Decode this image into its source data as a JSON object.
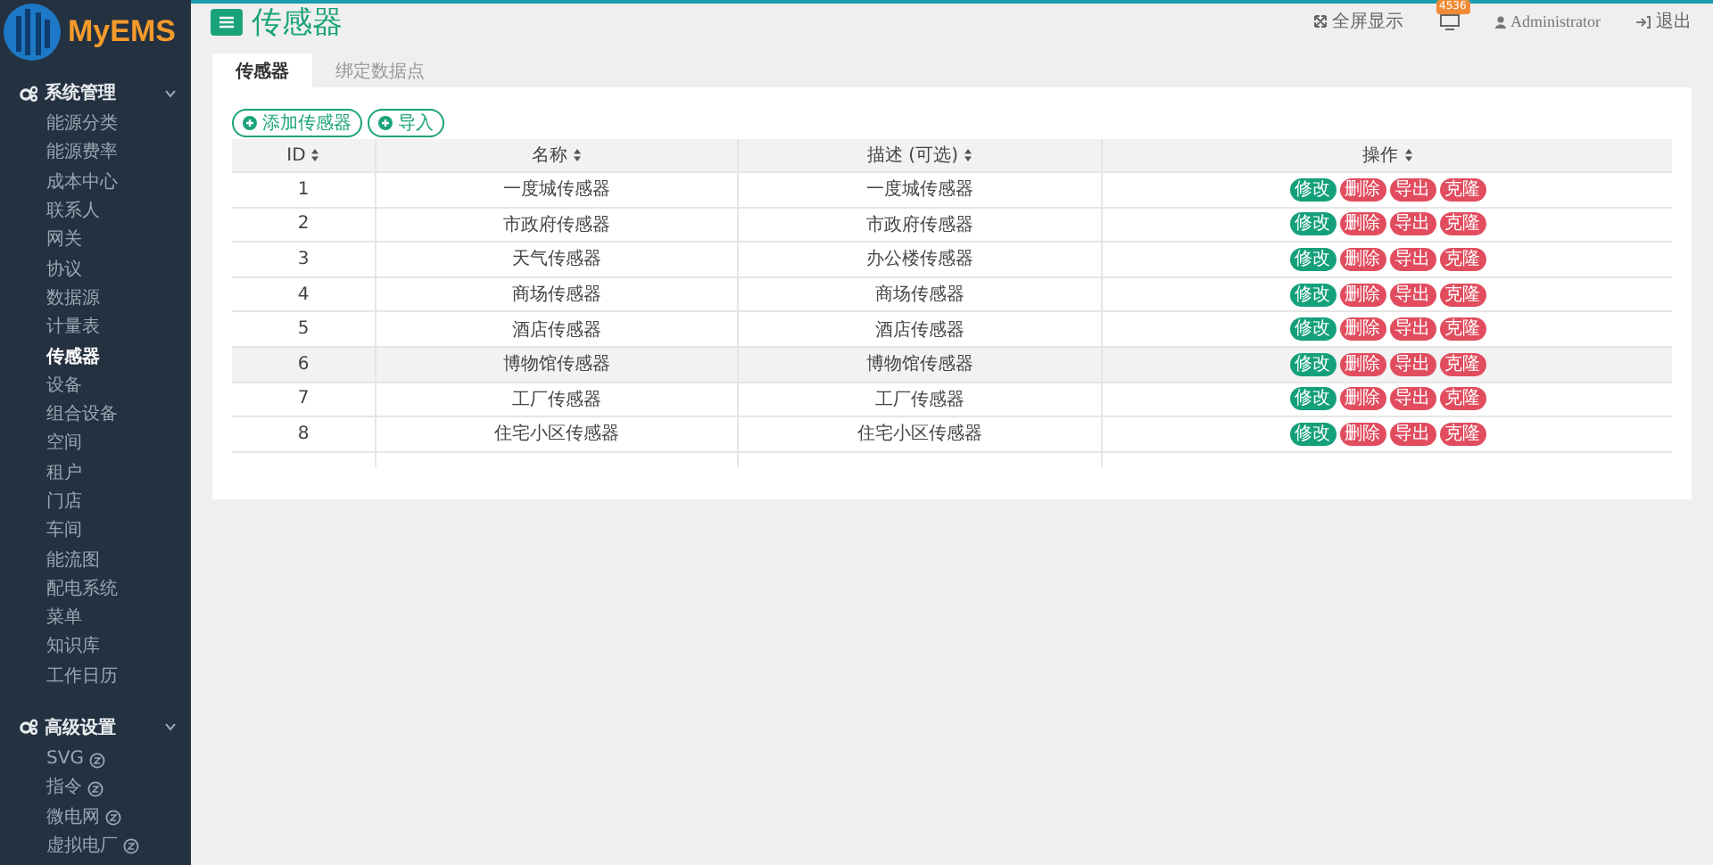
{
  "brand": {
    "name": "MyEMS"
  },
  "sidebar": {
    "groups": [
      {
        "label": "系统管理",
        "expanded": true,
        "items": [
          {
            "label": "能源分类",
            "selected": false,
            "kind": "plain"
          },
          {
            "label": "能源费率",
            "selected": false,
            "kind": "plain"
          },
          {
            "label": "成本中心",
            "selected": false,
            "kind": "plain"
          },
          {
            "label": "联系人",
            "selected": false,
            "kind": "plain"
          },
          {
            "label": "网关",
            "selected": false,
            "kind": "plain"
          },
          {
            "label": "协议",
            "selected": false,
            "kind": "plain"
          },
          {
            "label": "数据源",
            "selected": false,
            "kind": "plain"
          },
          {
            "label": "计量表",
            "selected": false,
            "kind": "plain"
          },
          {
            "label": "传感器",
            "selected": true,
            "kind": "plain"
          },
          {
            "label": "设备",
            "selected": false,
            "kind": "plain"
          },
          {
            "label": "组合设备",
            "selected": false,
            "kind": "plain"
          },
          {
            "label": "空间",
            "selected": false,
            "kind": "plain"
          },
          {
            "label": "租户",
            "selected": false,
            "kind": "plain"
          },
          {
            "label": "门店",
            "selected": false,
            "kind": "plain"
          },
          {
            "label": "车间",
            "selected": false,
            "kind": "plain"
          },
          {
            "label": "能流图",
            "selected": false,
            "kind": "plain"
          },
          {
            "label": "配电系统",
            "selected": false,
            "kind": "plain"
          },
          {
            "label": "菜单",
            "selected": false,
            "kind": "plain"
          },
          {
            "label": "知识库",
            "selected": false,
            "kind": "plain"
          },
          {
            "label": "工作日历",
            "selected": false,
            "kind": "plain"
          }
        ]
      },
      {
        "label": "高级设置",
        "expanded": true,
        "items": [
          {
            "label": "SVG",
            "selected": false,
            "kind": "pro"
          },
          {
            "label": "指令",
            "selected": false,
            "kind": "pro"
          },
          {
            "label": "微电网",
            "selected": false,
            "kind": "pro"
          },
          {
            "label": "虚拟电厂",
            "selected": false,
            "kind": "pro"
          }
        ]
      }
    ]
  },
  "topbar": {
    "page_title": "传感器",
    "fullscreen": "全屏显示",
    "notification_badge": "4536",
    "user": "Administrator",
    "logout": "退出"
  },
  "tabs": [
    {
      "label": "传感器",
      "selected": true
    },
    {
      "label": "绑定数据点",
      "selected": false
    }
  ],
  "toolbar": {
    "buttons": [
      "添加传感器",
      "导入"
    ]
  },
  "table": {
    "columns": [
      "ID",
      "名称",
      "描述 (可选)",
      "操作"
    ],
    "rows": [
      {
        "id": "1",
        "name": "一度城传感器",
        "description": "一度城传感器",
        "selected": false,
        "actions": [
          {
            "label": "修改",
            "kind": "edit"
          },
          {
            "label": "删除",
            "kind": "delete"
          },
          {
            "label": "导出",
            "kind": "export"
          },
          {
            "label": "克隆",
            "kind": "clone"
          }
        ]
      },
      {
        "id": "2",
        "name": "市政府传感器",
        "description": "市政府传感器",
        "selected": false,
        "actions": [
          {
            "label": "修改",
            "kind": "edit"
          },
          {
            "label": "删除",
            "kind": "delete"
          },
          {
            "label": "导出",
            "kind": "export"
          },
          {
            "label": "克隆",
            "kind": "clone"
          }
        ]
      },
      {
        "id": "3",
        "name": "天气传感器",
        "description": "办公楼传感器",
        "selected": false,
        "actions": [
          {
            "label": "修改",
            "kind": "edit"
          },
          {
            "label": "删除",
            "kind": "delete"
          },
          {
            "label": "导出",
            "kind": "export"
          },
          {
            "label": "克隆",
            "kind": "clone"
          }
        ]
      },
      {
        "id": "4",
        "name": "商场传感器",
        "description": "商场传感器",
        "selected": false,
        "actions": [
          {
            "label": "修改",
            "kind": "edit"
          },
          {
            "label": "删除",
            "kind": "delete"
          },
          {
            "label": "导出",
            "kind": "export"
          },
          {
            "label": "克隆",
            "kind": "clone"
          }
        ]
      },
      {
        "id": "5",
        "name": "酒店传感器",
        "description": "酒店传感器",
        "selected": false,
        "actions": [
          {
            "label": "修改",
            "kind": "edit"
          },
          {
            "label": "删除",
            "kind": "delete"
          },
          {
            "label": "导出",
            "kind": "export"
          },
          {
            "label": "克隆",
            "kind": "clone"
          }
        ]
      },
      {
        "id": "6",
        "name": "博物馆传感器",
        "description": "博物馆传感器",
        "selected": true,
        "actions": [
          {
            "label": "修改",
            "kind": "edit"
          },
          {
            "label": "删除",
            "kind": "delete"
          },
          {
            "label": "导出",
            "kind": "export"
          },
          {
            "label": "克隆",
            "kind": "clone"
          }
        ]
      },
      {
        "id": "7",
        "name": "工厂传感器",
        "description": "工厂传感器",
        "selected": false,
        "actions": [
          {
            "label": "修改",
            "kind": "edit"
          },
          {
            "label": "删除",
            "kind": "delete"
          },
          {
            "label": "导出",
            "kind": "export"
          },
          {
            "label": "克隆",
            "kind": "clone"
          }
        ]
      },
      {
        "id": "8",
        "name": "住宅小区传感器",
        "description": "住宅小区传感器",
        "selected": false,
        "actions": [
          {
            "label": "修改",
            "kind": "edit"
          },
          {
            "label": "删除",
            "kind": "delete"
          },
          {
            "label": "导出",
            "kind": "export"
          },
          {
            "label": "克隆",
            "kind": "clone"
          }
        ]
      }
    ]
  }
}
